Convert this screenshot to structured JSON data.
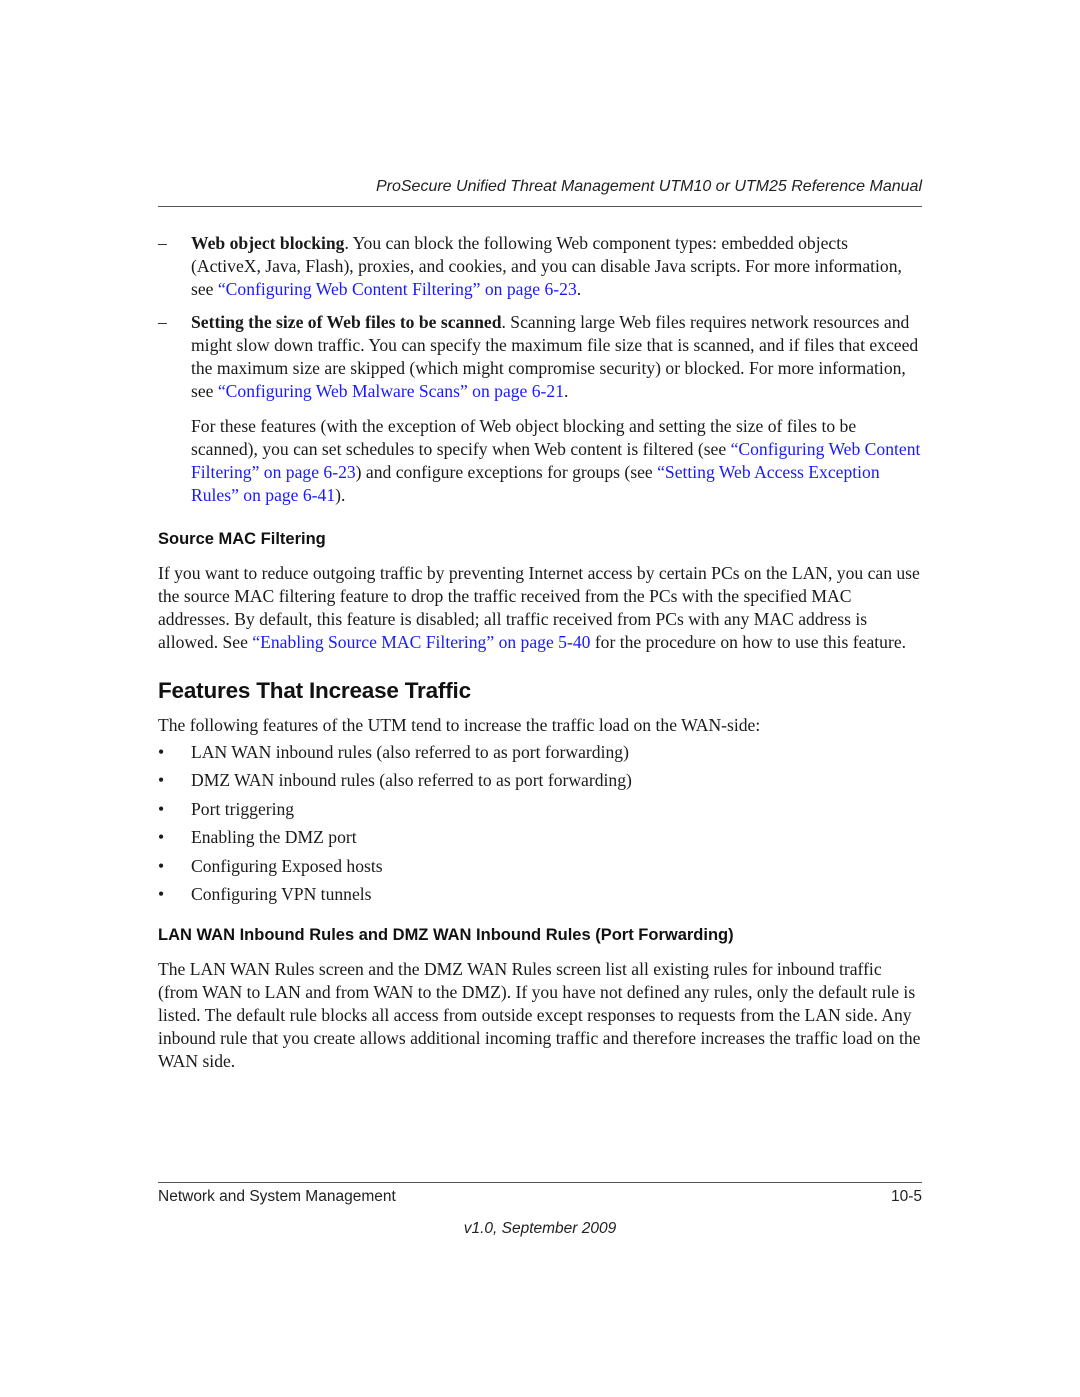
{
  "header": {
    "title": "ProSecure Unified Threat Management UTM10 or UTM25 Reference Manual"
  },
  "items": [
    {
      "bold": "Web object blocking",
      "text": ". You can block the following Web component types: embedded objects (ActiveX, Java, Flash), proxies, and cookies, and you can disable Java scripts. For more information, see ",
      "link": "“Configuring Web Content Filtering” on page 6-23",
      "after": "."
    },
    {
      "bold": "Setting the size of Web files to be scanned",
      "text": ". Scanning large Web files requires network resources and might slow down traffic. You can specify the maximum file size that is scanned, and if files that exceed the maximum size are skipped (which might compromise security) or blocked. For more information, see ",
      "link": "“Configuring Web Malware Scans” on page 6-21",
      "after": "."
    }
  ],
  "features_para": {
    "text1": "For these features (with the exception of Web object blocking and setting the size of files to be scanned), you can set schedules to specify when Web content is filtered (see ",
    "link1": "“Configuring Web Content Filtering” on page 6-23",
    "text2": ") and configure exceptions for groups (see ",
    "link2": "“Setting Web Access Exception Rules” on page 6-41",
    "text3": ")."
  },
  "source_mac": {
    "heading": "Source MAC Filtering",
    "text1": "If you want to reduce outgoing traffic by preventing Internet access by certain PCs on the LAN, you can use the source MAC filtering feature to drop the traffic received from the PCs with the specified MAC addresses. By default, this feature is disabled; all traffic received from PCs with any MAC address is allowed. See ",
    "link": "“Enabling Source MAC Filtering” on page 5-40",
    "text2": " for the procedure on how to use this feature."
  },
  "increase": {
    "heading": "Features That Increase Traffic",
    "intro": "The following features of the UTM tend to increase the traffic load on the WAN-side:",
    "bullets": [
      "LAN WAN inbound rules (also referred to as port forwarding)",
      "DMZ WAN inbound rules (also referred to as port forwarding)",
      "Port triggering",
      "Enabling the DMZ port",
      "Configuring Exposed hosts",
      "Configuring VPN tunnels"
    ]
  },
  "lan_wan": {
    "heading": "LAN WAN Inbound Rules and DMZ WAN Inbound Rules (Port Forwarding)",
    "text": "The LAN WAN Rules screen and the DMZ WAN Rules screen list all existing rules for inbound traffic (from WAN to LAN and from WAN to the DMZ). If you have not defined any rules, only the default rule is listed. The default rule blocks all access from outside except responses to requests from the LAN side. Any inbound rule that you create allows additional incoming traffic and therefore increases the traffic load on the WAN side."
  },
  "footer": {
    "section": "Network and System Management",
    "page": "10-5",
    "version": "v1.0, September 2009"
  },
  "symbols": {
    "dash": "–",
    "bullet": "•"
  },
  "colors": {
    "link": "#1a1aff"
  }
}
